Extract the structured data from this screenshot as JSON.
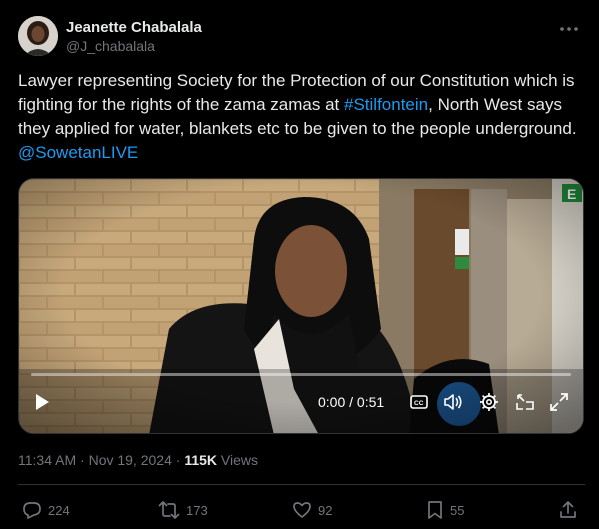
{
  "author": {
    "display_name": "Jeanette Chabalala",
    "handle": "@J_chabalala"
  },
  "tweet": {
    "text_1": "Lawyer representing Society for the Protection of our Constitution which is fighting for the rights of the zama zamas at ",
    "hashtag": "#Stilfontein",
    "text_2": ", North West says they applied for water, blankets etc to be given to the people underground. ",
    "mention": "@SowetanLIVE"
  },
  "video": {
    "time": "0:00 / 0:51",
    "progress_fraction": 0,
    "exit_sign_text": "E"
  },
  "meta": {
    "time": "11:34 AM",
    "separator_1": " · ",
    "date": "Nov 19, 2024",
    "separator_2": " · ",
    "views_count": "115K",
    "views_label": " Views"
  },
  "actions": {
    "replies": "224",
    "reposts": "173",
    "likes": "92",
    "bookmarks": "55"
  },
  "colors": {
    "accent": "#1d9bf0",
    "secondary_text": "#71767b",
    "background": "#000000"
  },
  "icons": [
    "more-icon",
    "play-icon",
    "captions-icon",
    "volume-icon",
    "settings-icon",
    "pip-icon",
    "fullscreen-icon",
    "reply-icon",
    "repost-icon",
    "like-icon",
    "bookmark-icon",
    "share-icon"
  ]
}
